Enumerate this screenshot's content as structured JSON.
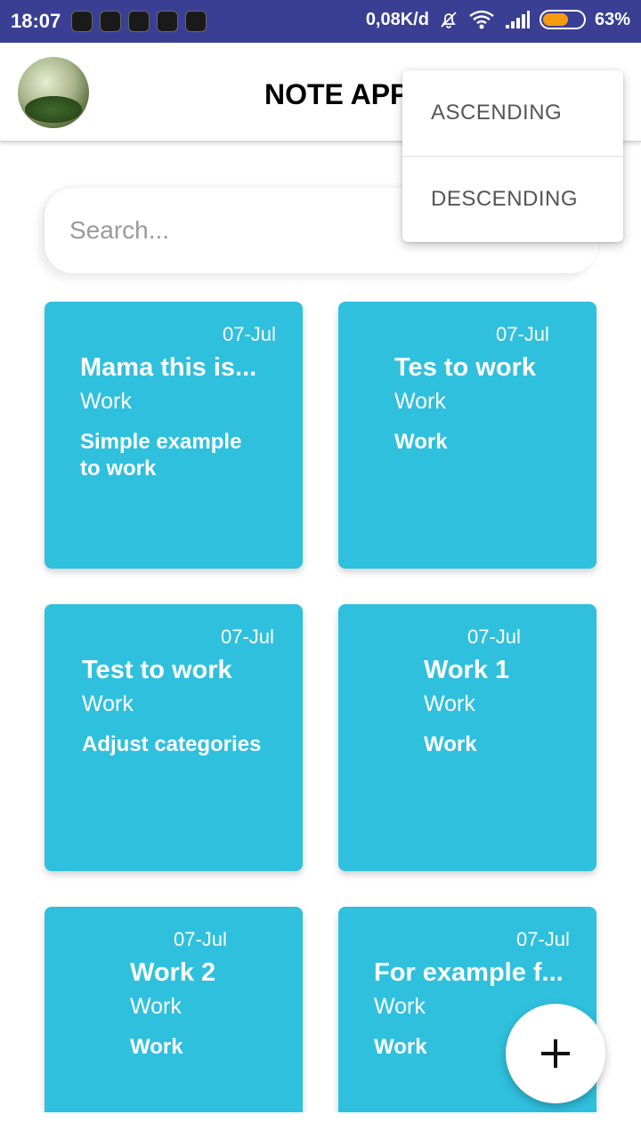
{
  "status_bar": {
    "time": "18:07",
    "network_speed": "0,08K/d",
    "battery_percent": "63%",
    "battery_level": 0.63,
    "icons": [
      "notification-icon-1",
      "notification-icon-2",
      "notification-icon-3",
      "notification-icon-4",
      "notification-icon-5",
      "mute-bell-icon",
      "wifi-icon",
      "signal-icon",
      "battery-icon"
    ],
    "battery_color": "#f39c12",
    "background_color": "#3a3f94"
  },
  "app_bar": {
    "title": "NOTE APP"
  },
  "search": {
    "placeholder": "Search..."
  },
  "sort_menu": {
    "items": [
      {
        "label": "ASCENDING"
      },
      {
        "label": "DESCENDING"
      }
    ]
  },
  "notes": [
    {
      "date": "07-Jul",
      "title": "Mama this is...",
      "category": "Work",
      "content": "Simple example to work"
    },
    {
      "date": "07-Jul",
      "title": "Tes to work",
      "category": "Work",
      "content": "Work"
    },
    {
      "date": "07-Jul",
      "title": "Test to work",
      "category": "Work",
      "content": "Adjust categories"
    },
    {
      "date": "07-Jul",
      "title": "Work 1",
      "category": "Work",
      "content": "Work"
    },
    {
      "date": "07-Jul",
      "title": "Work 2",
      "category": "Work",
      "content": "Work"
    },
    {
      "date": "07-Jul",
      "title": "For example f...",
      "category": "Work",
      "content": "Work"
    }
  ],
  "colors": {
    "card": "#2fc0de",
    "text_on_card": "#ffffff",
    "menu_text": "#555555"
  },
  "fab": {
    "icon": "plus-icon"
  }
}
